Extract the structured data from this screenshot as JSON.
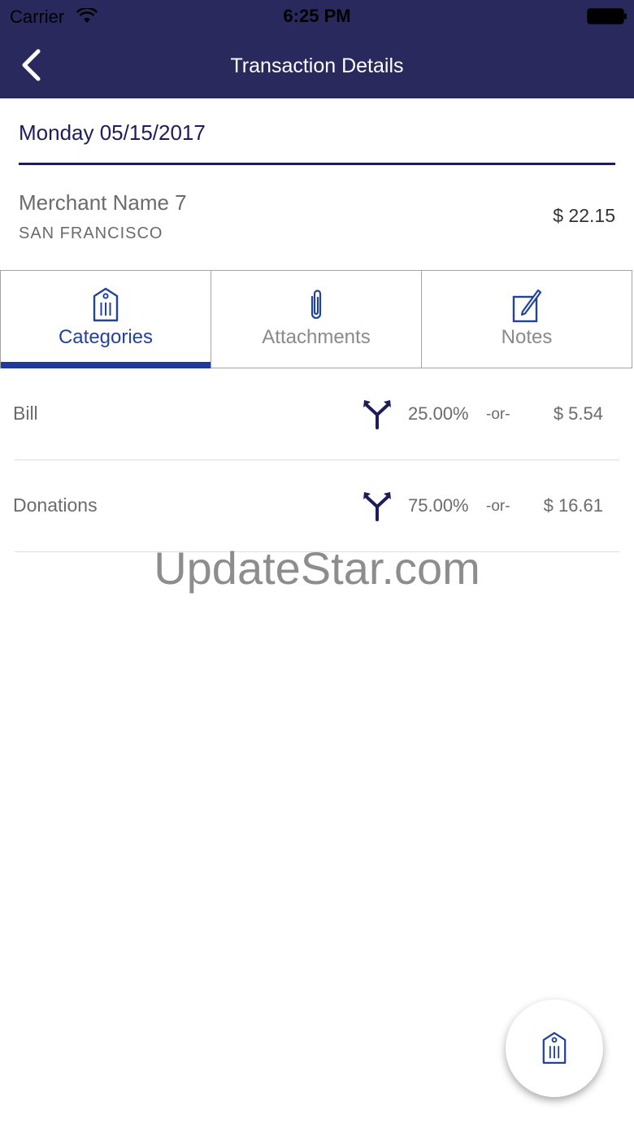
{
  "status_bar": {
    "carrier": "Carrier",
    "time": "6:25 PM"
  },
  "nav": {
    "title": "Transaction Details",
    "back_icon": "chevron-left-icon"
  },
  "transaction": {
    "date": "Monday 05/15/2017",
    "merchant_name": "Merchant Name 7",
    "merchant_city": "SAN FRANCISCO",
    "amount": "$ 22.15"
  },
  "tabs": [
    {
      "label": "Categories",
      "icon": "tag-icon",
      "active": true
    },
    {
      "label": "Attachments",
      "icon": "paperclip-icon",
      "active": false
    },
    {
      "label": "Notes",
      "icon": "edit-note-icon",
      "active": false
    }
  ],
  "categories": [
    {
      "name": "Bill",
      "percent": "25.00%",
      "or_label": "-or-",
      "amount": "$ 5.54",
      "icon": "split-icon"
    },
    {
      "name": "Donations",
      "percent": "75.00%",
      "or_label": "-or-",
      "amount": "$ 16.61",
      "icon": "split-icon"
    }
  ],
  "watermark": "UpdateStar.com",
  "fab": {
    "icon": "tag-icon"
  },
  "colors": {
    "nav_background": "#29295e",
    "accent": "#1f3a9a",
    "date_text": "#1d1d5a",
    "muted_text": "#6b6b6b"
  }
}
